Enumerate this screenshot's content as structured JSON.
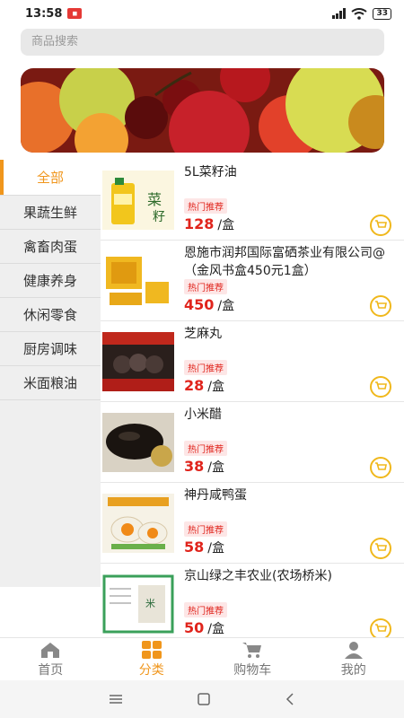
{
  "status": {
    "time": "13:58",
    "battery": "33"
  },
  "search": {
    "placeholder": "商品搜索"
  },
  "categories": [
    {
      "label": "全部",
      "active": true
    },
    {
      "label": "果蔬生鲜"
    },
    {
      "label": "禽畜肉蛋"
    },
    {
      "label": "健康养身"
    },
    {
      "label": "休闲零食"
    },
    {
      "label": "厨房调味"
    },
    {
      "label": "米面粮油"
    }
  ],
  "products": [
    {
      "name": "5L菜籽油",
      "tag": "热门推荐",
      "price": "128",
      "unit": "/盒"
    },
    {
      "name": "恩施市润邦国际富硒茶业有限公司@（金风书盒450元1盒）",
      "tag": "热门推荐",
      "price": "450",
      "unit": "/盒"
    },
    {
      "name": "芝麻丸",
      "tag": "热门推荐",
      "price": "28",
      "unit": "/盒"
    },
    {
      "name": "小米醋",
      "tag": "热门推荐",
      "price": "38",
      "unit": "/盒"
    },
    {
      "name": "神丹咸鸭蛋",
      "tag": "热门推荐",
      "price": "58",
      "unit": "/盒"
    },
    {
      "name": "京山绿之丰农业(农场桥米)",
      "tag": "热门推荐",
      "price": "50",
      "unit": "/盒"
    }
  ],
  "tabs": [
    {
      "label": "首页",
      "icon": "home-icon"
    },
    {
      "label": "分类",
      "icon": "category-icon",
      "active": true
    },
    {
      "label": "购物车",
      "icon": "cart-icon"
    },
    {
      "label": "我的",
      "icon": "profile-icon"
    }
  ],
  "colors": {
    "accent": "#f0961c",
    "price": "#e0241c",
    "cart": "#f0b81c"
  }
}
